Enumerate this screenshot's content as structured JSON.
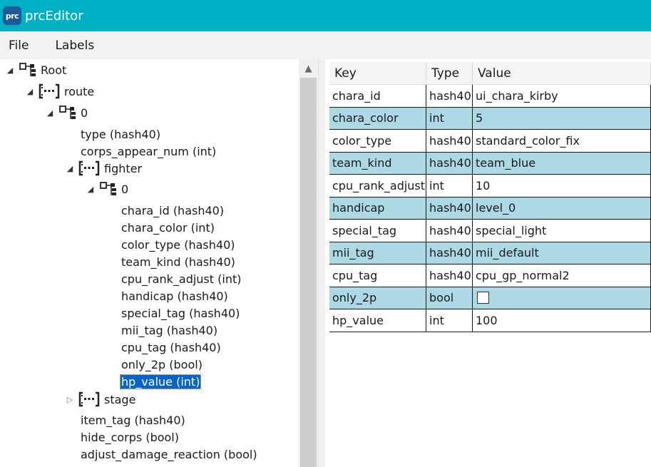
{
  "window": {
    "app_icon_text": "prc",
    "title": "prcEditor"
  },
  "menu": [
    "File",
    "Labels"
  ],
  "tree": [
    {
      "label": "Root",
      "icon": "struct-icon",
      "expander": "expanded",
      "depth": 0
    },
    {
      "label": "route",
      "icon": "list-icon",
      "expander": "expanded",
      "depth": 1
    },
    {
      "label": "0",
      "icon": "struct-icon",
      "expander": "expanded",
      "depth": 2
    },
    {
      "label": "type (hash40)",
      "icon": "",
      "expander": "",
      "depth": 3
    },
    {
      "label": "corps_appear_num (int)",
      "icon": "",
      "expander": "",
      "depth": 3
    },
    {
      "label": "fighter",
      "icon": "list-icon",
      "expander": "expanded",
      "depth": 3
    },
    {
      "label": "0",
      "icon": "struct-icon",
      "expander": "expanded",
      "depth": 4
    },
    {
      "label": "chara_id (hash40)",
      "icon": "",
      "expander": "",
      "depth": 5
    },
    {
      "label": "chara_color (int)",
      "icon": "",
      "expander": "",
      "depth": 5
    },
    {
      "label": "color_type (hash40)",
      "icon": "",
      "expander": "",
      "depth": 5
    },
    {
      "label": "team_kind (hash40)",
      "icon": "",
      "expander": "",
      "depth": 5
    },
    {
      "label": "cpu_rank_adjust (int)",
      "icon": "",
      "expander": "",
      "depth": 5
    },
    {
      "label": "handicap (hash40)",
      "icon": "",
      "expander": "",
      "depth": 5
    },
    {
      "label": "special_tag (hash40)",
      "icon": "",
      "expander": "",
      "depth": 5
    },
    {
      "label": "mii_tag (hash40)",
      "icon": "",
      "expander": "",
      "depth": 5
    },
    {
      "label": "cpu_tag (hash40)",
      "icon": "",
      "expander": "",
      "depth": 5
    },
    {
      "label": "only_2p (bool)",
      "icon": "",
      "expander": "",
      "depth": 5
    },
    {
      "label": "hp_value (int)",
      "icon": "",
      "expander": "",
      "depth": 5,
      "selected": true
    },
    {
      "label": "stage",
      "icon": "list-icon",
      "expander": "collapsed",
      "depth": 3
    },
    {
      "label": "item_tag (hash40)",
      "icon": "",
      "expander": "",
      "depth": 3
    },
    {
      "label": "hide_corps (bool)",
      "icon": "",
      "expander": "",
      "depth": 3
    },
    {
      "label": "adjust_damage_reaction (bool)",
      "icon": "",
      "expander": "",
      "depth": 3
    }
  ],
  "grid": {
    "headers": {
      "key": "Key",
      "type": "Type",
      "value": "Value"
    },
    "rows": [
      {
        "key": "chara_id",
        "type": "hash40",
        "value": "ui_chara_kirby"
      },
      {
        "key": "chara_color",
        "type": "int",
        "value": "5"
      },
      {
        "key": "color_type",
        "type": "hash40",
        "value": "standard_color_fix"
      },
      {
        "key": "team_kind",
        "type": "hash40",
        "value": "team_blue"
      },
      {
        "key": "cpu_rank_adjust",
        "type": "int",
        "value": "10"
      },
      {
        "key": "handicap",
        "type": "hash40",
        "value": "level_0"
      },
      {
        "key": "special_tag",
        "type": "hash40",
        "value": "special_light"
      },
      {
        "key": "mii_tag",
        "type": "hash40",
        "value": "mii_default"
      },
      {
        "key": "cpu_tag",
        "type": "hash40",
        "value": "cpu_gp_normal2"
      },
      {
        "key": "only_2p",
        "type": "bool",
        "value": "",
        "checkbox": true,
        "checked": false
      },
      {
        "key": "hp_value",
        "type": "int",
        "value": "100"
      }
    ]
  },
  "colors": {
    "titlebar": "#00b0c4",
    "row_alt": "#add8e6",
    "selection": "#0a64c8"
  }
}
